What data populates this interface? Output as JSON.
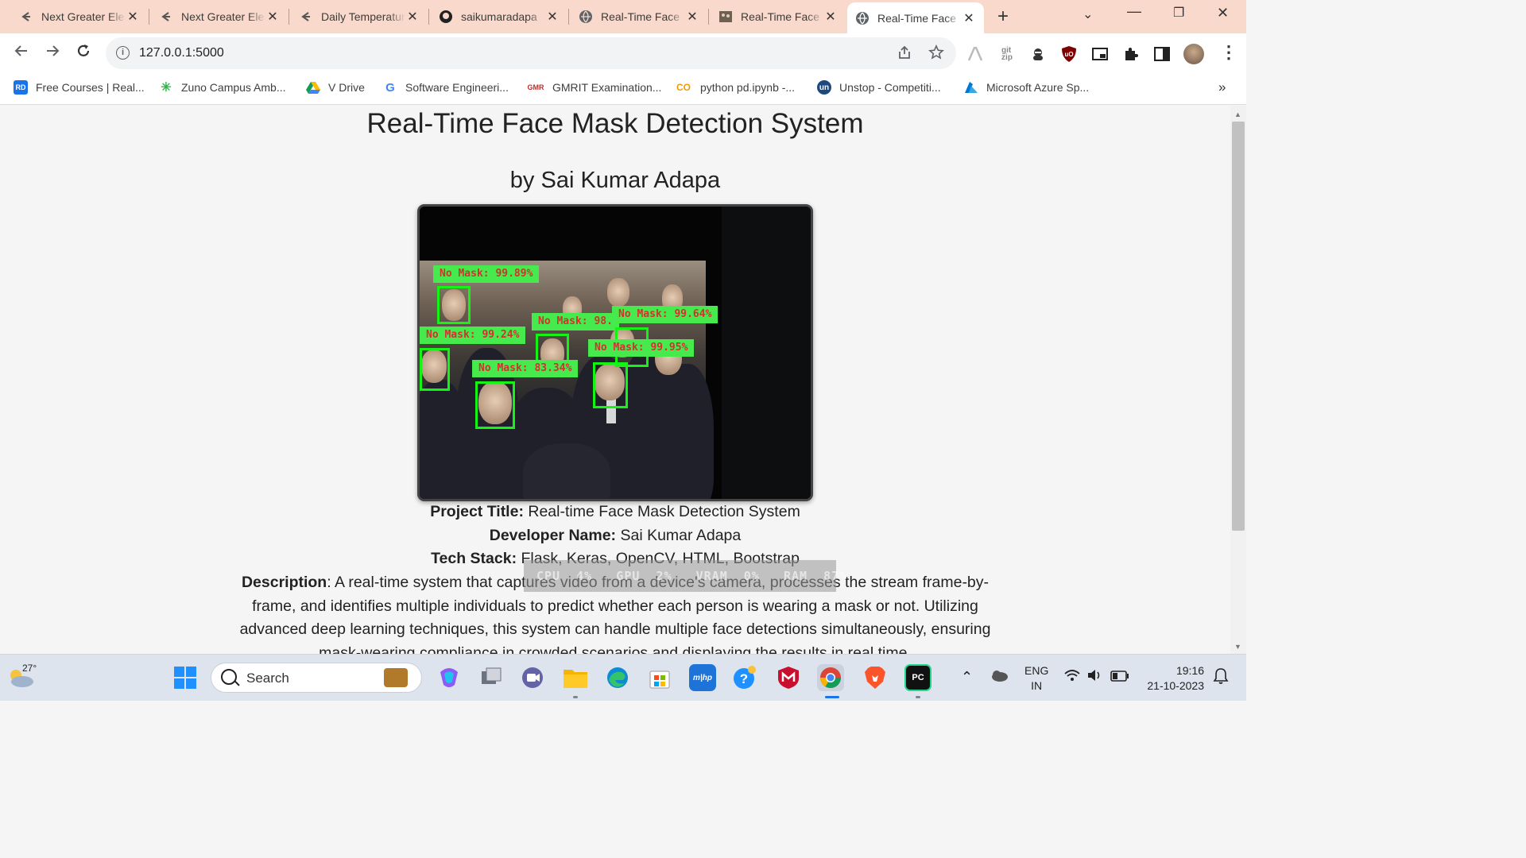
{
  "browser": {
    "tabs": [
      {
        "title": "Next Greater Element",
        "icon": "gfg-icon"
      },
      {
        "title": "Next Greater Element",
        "icon": "gfg-icon"
      },
      {
        "title": "Daily Temperatures",
        "icon": "gfg-icon"
      },
      {
        "title": "saikumaradapa",
        "icon": "github-icon"
      },
      {
        "title": "Real-Time Face",
        "icon": "globe-icon"
      },
      {
        "title": "Real-Time Face",
        "icon": "image-icon"
      },
      {
        "title": "Real-Time Face",
        "icon": "globe-icon"
      }
    ],
    "url": "127.0.0.1:5000",
    "bookmarks": [
      {
        "label": "Free Courses | Real...",
        "icon": "RD"
      },
      {
        "label": "Zuno Campus Amb...",
        "icon": "✳"
      },
      {
        "label": "V Drive",
        "icon": "▲"
      },
      {
        "label": "Software Engineeri...",
        "icon": "G"
      },
      {
        "label": "GMRIT Examination...",
        "icon": "GMR"
      },
      {
        "label": "python pd.ipynb -...",
        "icon": "CO"
      },
      {
        "label": "Unstop - Competiti...",
        "icon": "un"
      },
      {
        "label": "Microsoft Azure Sp...",
        "icon": "A"
      }
    ]
  },
  "page": {
    "title": "Real-Time Face Mask Detection System",
    "subtitle": "by Sai Kumar Adapa",
    "detections": [
      {
        "label": "No Mask: 99.89%"
      },
      {
        "label": "No Mask: 99.24%"
      },
      {
        "label": "No Mask: 98."
      },
      {
        "label": "No Mask: 99.64%"
      },
      {
        "label": "No Mask: 99.95%"
      },
      {
        "label": "No Mask: 83.34%"
      }
    ],
    "info": {
      "project_title_label": "Project Title:",
      "project_title": " Real-time Face Mask Detection System",
      "developer_label": "Developer Name:",
      "developer": " Sai Kumar Adapa",
      "tech_label": "Tech Stack:",
      "tech": " Flask, Keras, OpenCV, HTML, Bootstrap",
      "description_label": "Description",
      "description": ": A real-time system that captures video from a device's camera, processes the stream frame-by-frame, and identifies multiple individuals to predict whether each person is wearing a mask or not. Utilizing advanced deep learning techniques, this system can handle multiple face detections simultaneously, ensuring mask-wearing compliance in crowded scenarios and displaying the results in real time."
    },
    "overlay_stats": "CPU  4%   GPU  2%   VRAM  0%   RAM  87%"
  },
  "taskbar": {
    "temperature": "27°",
    "search_placeholder": "Search",
    "lang_line1": "ENG",
    "lang_line2": "IN",
    "time": "19:16",
    "date": "21-10-2023"
  },
  "colors": {
    "tabstrip": "#f8d9cb",
    "box": "#14f314",
    "label_bg": "#46ea4c",
    "label_text": "#d43030"
  }
}
